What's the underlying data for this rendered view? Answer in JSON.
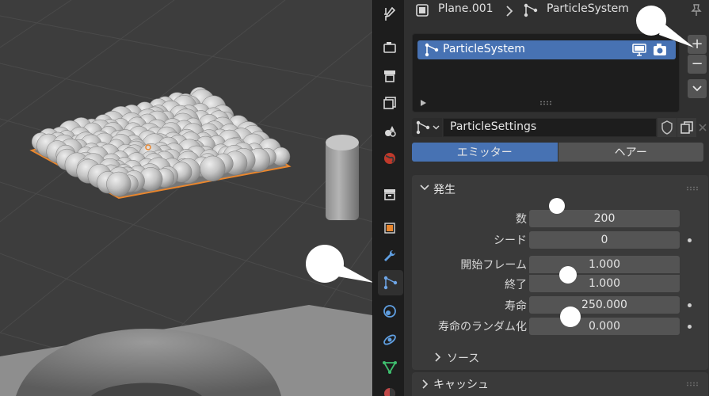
{
  "breadcrumb": {
    "object": "Plane.001",
    "system": "ParticleSystem"
  },
  "particle_list": {
    "item_label": "ParticleSystem"
  },
  "list_controls": {
    "add_label": "+",
    "remove_label": "−"
  },
  "settings_block": {
    "name": "ParticleSettings"
  },
  "tabs": [
    {
      "label": "エミッター",
      "active": true
    },
    {
      "label": "ヘアー",
      "active": false
    }
  ],
  "emission": {
    "title": "発生",
    "fields": [
      {
        "label": "数",
        "value": "200"
      },
      {
        "label": "シード",
        "value": "0"
      },
      {
        "label": "開始フレーム",
        "value": "1.000"
      },
      {
        "label": "終了",
        "value": "1.000"
      },
      {
        "label": "寿命",
        "value": "250.000"
      },
      {
        "label": "寿命のランダム化",
        "value": "0.000"
      }
    ],
    "source_label": "ソース"
  },
  "cache": {
    "title": "キャッシュ"
  },
  "colors": {
    "accent": "#4772b3",
    "panel_bg": "#303030",
    "field_bg": "#545454",
    "viewport_bg": "#3d3d3d"
  },
  "icons": {
    "tools": [
      "tool-settings-icon",
      "render-icon",
      "output-icon",
      "view-layer-icon",
      "scene-icon",
      "world-icon",
      "collection-icon",
      "object-icon",
      "modifier-icon",
      "particles-icon",
      "physics-icon",
      "constraints-icon",
      "data-icon",
      "material-icon"
    ]
  }
}
